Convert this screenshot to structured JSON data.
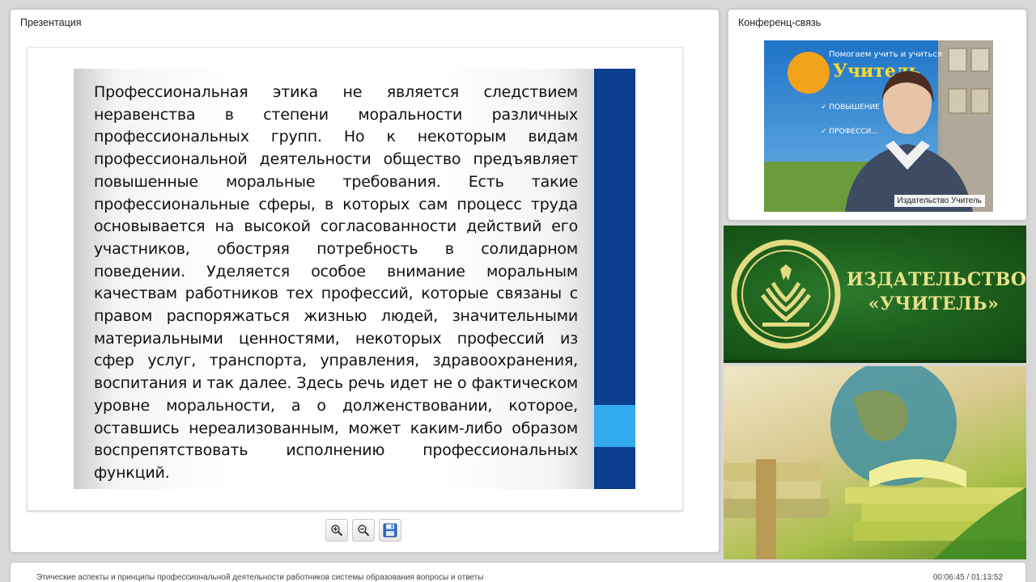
{
  "presentation": {
    "panel_title": "Презентация",
    "slide_text": "Профессиональная этика не является следствием неравенства в степени моральности различных профессиональных групп. Но к некоторым видам профессиональной деятельности общество предъявляет повышенные моральные требования. Есть такие профессиональные сферы, в которых сам процесс труда основывается на высокой согласованности действий его участников, обостряя потребность в солидарном поведении. Уделяется особое внимание моральным качествам работников тех профессий, которые связаны с правом распоряжаться жизнью людей, значительными материальными ценностями, некоторых профессий из сфер услуг, транспорта, управления, здравоохранения, воспитания и так далее. Здесь речь идет не о фактическом уровне моральности, а о долженствовании, которое, оставшись нереализованным, может каким-либо образом воспрепятствовать исполнению профессиональных функций.",
    "controls": [
      {
        "name": "zoom-in",
        "icon": "zoom-in-icon"
      },
      {
        "name": "zoom-out",
        "icon": "zoom-out-icon"
      },
      {
        "name": "save",
        "icon": "floppy-disk-icon"
      }
    ]
  },
  "conference": {
    "panel_title": "Конференц-связь",
    "video_caption": "Издательство Учитель"
  },
  "promo": {
    "title_line1": "ИЗДАТЕЛЬСТВО",
    "title_line2": "«УЧИТЕЛЬ»"
  },
  "footer": {
    "title": "Этические аспекты и принципы профессиональной деятельности работников системы образования вопросы и ответы",
    "time": "00:06:45 / 01:13:52"
  }
}
